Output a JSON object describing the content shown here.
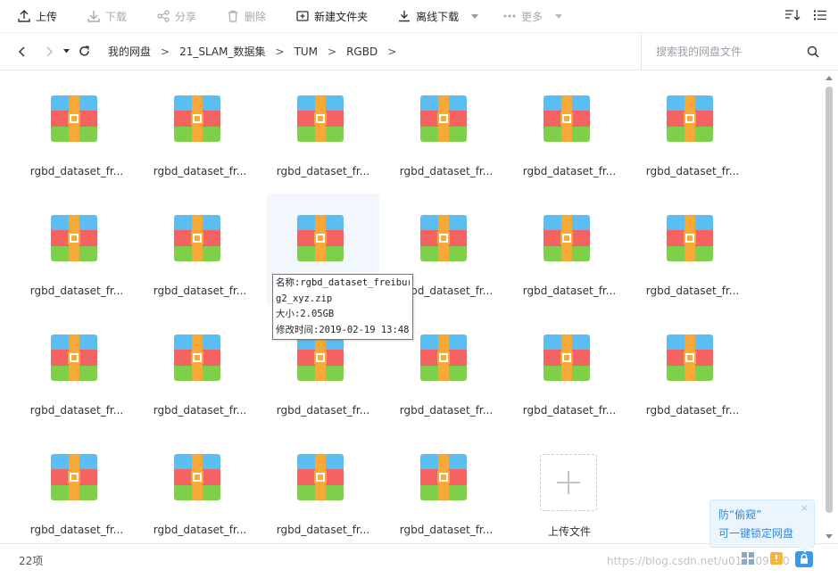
{
  "toolbar": {
    "upload": "上传",
    "download": "下载",
    "share": "分享",
    "delete": "删除",
    "new_folder": "新建文件夹",
    "offline_download": "离线下载",
    "more": "更多"
  },
  "address": {
    "breadcrumbs": [
      "我的网盘",
      "21_SLAM_数据集",
      "TUM",
      "RGBD"
    ],
    "separator": ">",
    "search_placeholder": "搜索我的网盘文件"
  },
  "files": [
    {
      "name": "rgbd_dataset_fr..."
    },
    {
      "name": "rgbd_dataset_fr..."
    },
    {
      "name": "rgbd_dataset_fr..."
    },
    {
      "name": "rgbd_dataset_fr..."
    },
    {
      "name": "rgbd_dataset_fr..."
    },
    {
      "name": "rgbd_dataset_fr..."
    },
    {
      "name": "rgbd_dataset_fr..."
    },
    {
      "name": "rgbd_dataset_fr..."
    },
    {
      "name": ""
    },
    {
      "name": "rgbd_dataset_fr..."
    },
    {
      "name": "rgbd_dataset_fr..."
    },
    {
      "name": "rgbd_dataset_fr..."
    },
    {
      "name": "rgbd_dataset_fr..."
    },
    {
      "name": "rgbd_dataset_fr..."
    },
    {
      "name": "rgbd_dataset_fr..."
    },
    {
      "name": "rgbd_dataset_fr..."
    },
    {
      "name": "rgbd_dataset_fr..."
    },
    {
      "name": "rgbd_dataset_fr..."
    },
    {
      "name": "rgbd_dataset_fr..."
    },
    {
      "name": "rgbd_dataset_fr..."
    },
    {
      "name": "rgbd_dataset_fr..."
    },
    {
      "name": "rgbd_dataset_fr..."
    }
  ],
  "upload_tile": {
    "label": "上传文件"
  },
  "tooltip": {
    "line1": "名称:rgbd_dataset_freibur",
    "line2": "g2_xyz.zip",
    "line3": "大小:2.05GB",
    "line4": "修改时间:2019-02-19 13:48"
  },
  "status": {
    "count": "22项",
    "watermark": "https://blog.csdn.net/u014709760"
  },
  "promo": {
    "line1": "防“偷窥”",
    "line2": "可一键锁定网盘",
    "close": "×"
  },
  "colors": {
    "zip_blue": "#5bbef3",
    "zip_red": "#f46262",
    "zip_green": "#7ed04b",
    "zip_strap": "#f7a938",
    "accent": "#2a8ce6"
  }
}
